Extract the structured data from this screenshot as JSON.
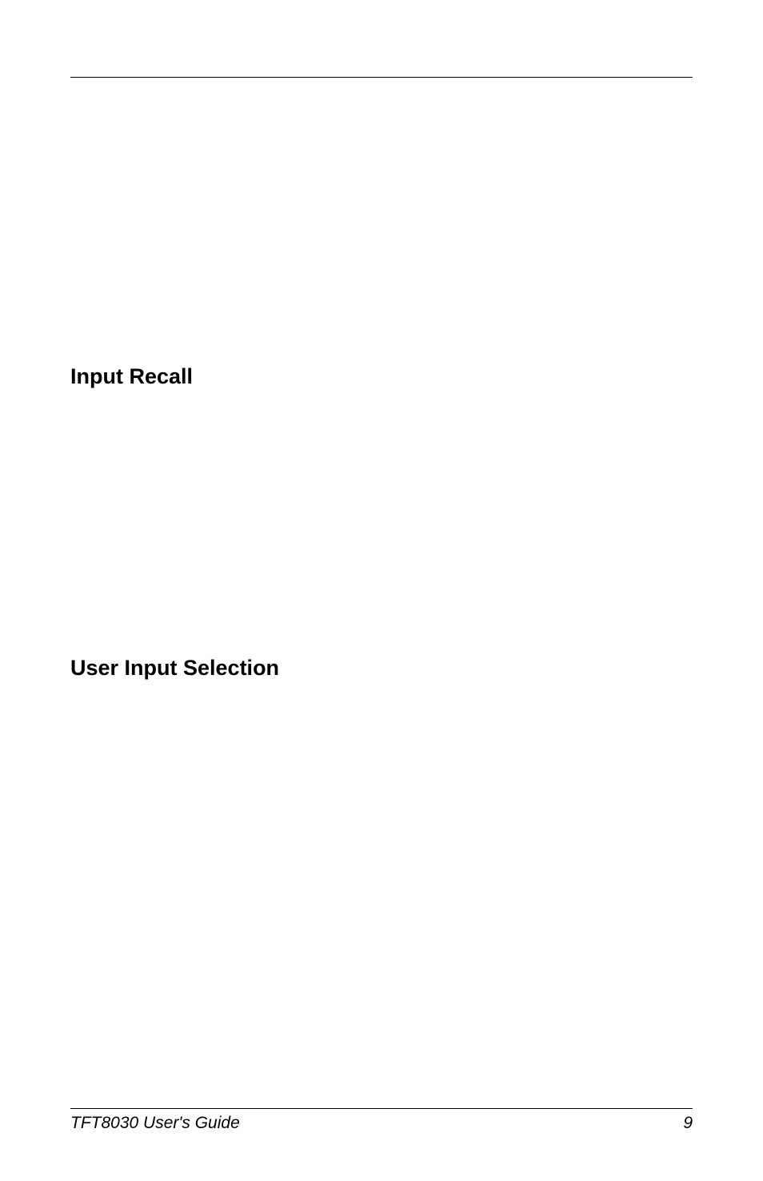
{
  "headings": {
    "input_recall": "Input Recall",
    "user_input_selection": "User Input Selection"
  },
  "footer": {
    "guide_title": "TFT8030 User's Guide",
    "page_number": "9"
  }
}
